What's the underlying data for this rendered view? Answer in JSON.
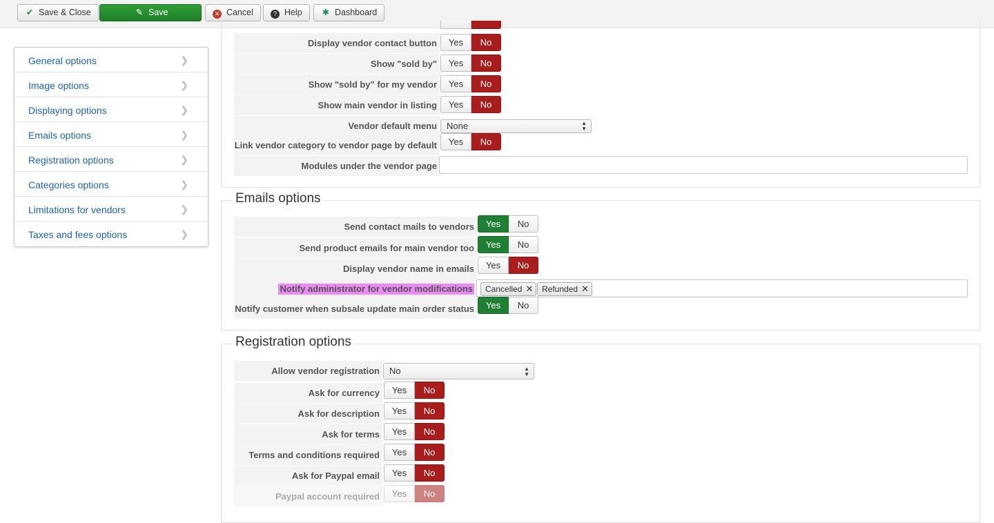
{
  "toolbar": {
    "save_close": "Save & Close",
    "save": "Save",
    "cancel": "Cancel",
    "help": "Help",
    "dashboard": "Dashboard"
  },
  "sidebar": {
    "items": [
      {
        "label": "General options"
      },
      {
        "label": "Image options"
      },
      {
        "label": "Displaying options"
      },
      {
        "label": "Emails options"
      },
      {
        "label": "Registration options"
      },
      {
        "label": "Categories options"
      },
      {
        "label": "Limitations for vendors"
      },
      {
        "label": "Taxes and fees options"
      }
    ]
  },
  "toggle_labels": {
    "yes": "Yes",
    "no": "No"
  },
  "displaying": {
    "rows": [
      {
        "label": "Display vendor contact button",
        "value": "No"
      },
      {
        "label": "Show \"sold by\"",
        "value": "No"
      },
      {
        "label": "Show \"sold by\" for my vendor",
        "value": "No"
      },
      {
        "label": "Show main vendor in listing",
        "value": "No"
      },
      {
        "label": "Vendor default menu",
        "value": "None"
      },
      {
        "label": "Link vendor category to vendor page by default",
        "value": "No"
      },
      {
        "label": "Modules under the vendor page",
        "value": ""
      }
    ]
  },
  "emails": {
    "legend": "Emails options",
    "rows": [
      {
        "label": "Send contact mails to vendors",
        "value": "Yes"
      },
      {
        "label": "Send product emails for main vendor too",
        "value": "Yes"
      },
      {
        "label": "Display vendor name in emails",
        "value": "No"
      },
      {
        "label": "Notify administrator for vendor modifications",
        "tags": [
          "Cancelled",
          "Refunded"
        ]
      },
      {
        "label": "Notify customer when subsale update main order status",
        "value": "Yes"
      }
    ]
  },
  "registration": {
    "legend": "Registration options",
    "rows": [
      {
        "label": "Allow vendor registration",
        "value": "No"
      },
      {
        "label": "Ask for currency",
        "value": "No"
      },
      {
        "label": "Ask for description",
        "value": "No"
      },
      {
        "label": "Ask for terms",
        "value": "No"
      },
      {
        "label": "Terms and conditions required",
        "value": "No"
      },
      {
        "label": "Ask for Paypal email",
        "value": "No"
      },
      {
        "label": "Paypal account required",
        "value": "No"
      }
    ]
  },
  "colors": {
    "no_active": "#a91d1d",
    "yes_active": "#1f7f32",
    "link": "#1f62a8",
    "highlight": "#ea8af3"
  }
}
